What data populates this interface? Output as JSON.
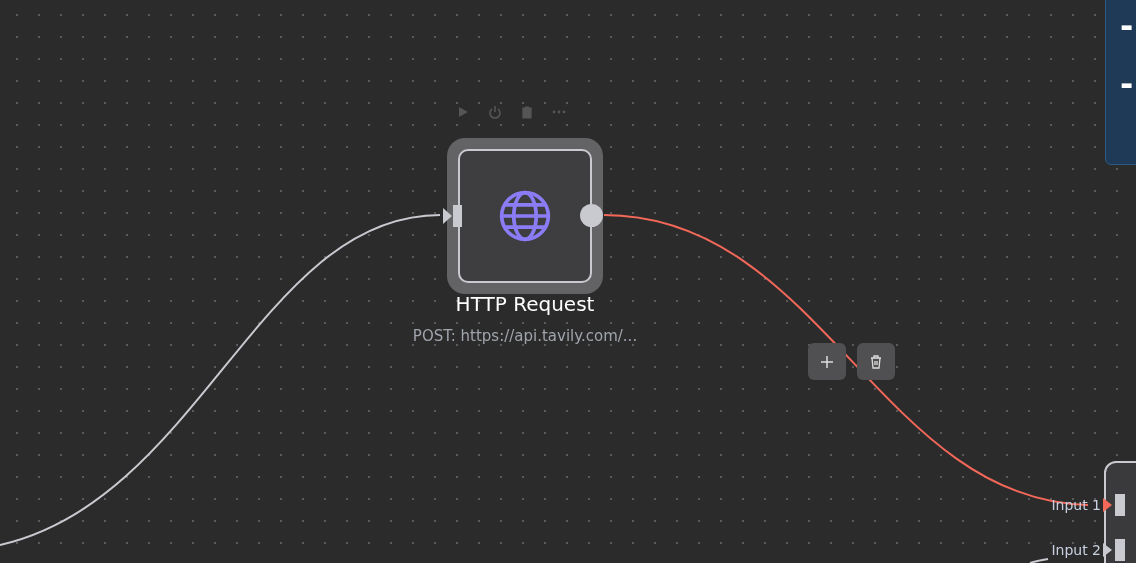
{
  "node_toolbar": [
    {
      "kind": "play"
    },
    {
      "kind": "power"
    },
    {
      "kind": "trash"
    },
    {
      "kind": "more"
    }
  ],
  "node": {
    "title": "HTTP Request",
    "subtitle": "POST: https://api.tavily.com/...",
    "selected": true
  },
  "edges": [
    {
      "kind": "incoming",
      "selected": false
    },
    {
      "kind": "outgoing",
      "selected": true
    },
    {
      "kind": "input2",
      "selected": false
    }
  ],
  "edge_actions": [
    {
      "kind": "add"
    },
    {
      "kind": "delete"
    }
  ],
  "target_node": {
    "inputs": [
      {
        "label": "Input 1",
        "connected_selected": true
      },
      {
        "label": "Input 2",
        "connected_selected": false
      }
    ]
  },
  "side_panel": {
    "lines": [
      "-",
      "-"
    ]
  }
}
